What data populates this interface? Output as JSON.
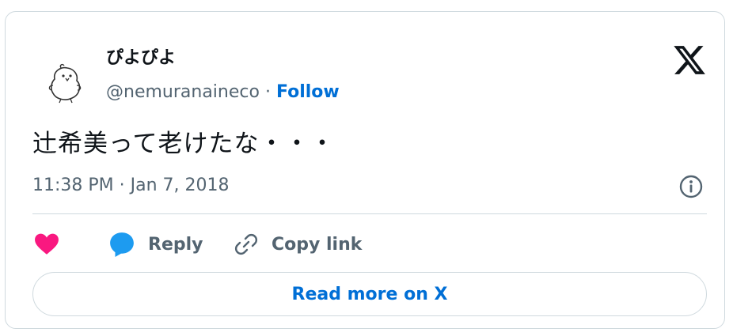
{
  "user": {
    "display_name": "ぴよぴよ",
    "handle": "@nemuranaineco",
    "separator": "·",
    "follow_label": "Follow"
  },
  "tweet": {
    "text": "辻希美って老けたな・・・",
    "timestamp": "11:38 PM · Jan 7, 2018"
  },
  "actions": {
    "reply_label": "Reply",
    "copy_link_label": "Copy link"
  },
  "read_more_label": "Read more on X",
  "colors": {
    "link": "#006fd6",
    "heart": "#f91880",
    "reply_bubble": "#1d9bf0",
    "text": "#0f1419",
    "muted": "#536471",
    "border": "#cfd9de"
  },
  "icons": [
    "avatar-bird-icon",
    "x-logo-icon",
    "info-icon",
    "heart-icon",
    "reply-bubble-icon",
    "link-icon"
  ]
}
